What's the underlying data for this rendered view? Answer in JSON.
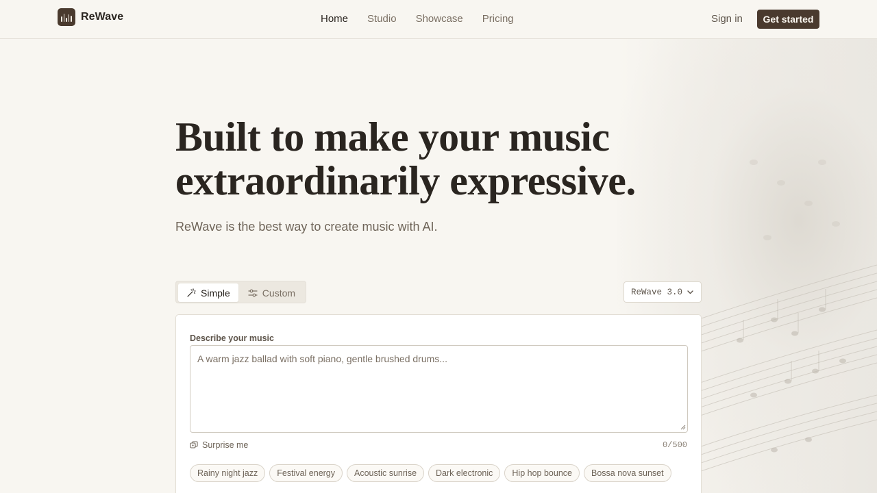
{
  "brand": {
    "name": "ReWave",
    "logo_icon": "bars-logo-icon"
  },
  "nav": {
    "items": [
      {
        "label": "Home",
        "active": true
      },
      {
        "label": "Studio",
        "active": false
      },
      {
        "label": "Showcase",
        "active": false
      },
      {
        "label": "Pricing",
        "active": false
      }
    ]
  },
  "header": {
    "signin_label": "Sign in",
    "cta_label": "Get started"
  },
  "hero": {
    "title_line1": "Built to make your music",
    "title_line2": "extraordinarily expressive.",
    "subtitle": "ReWave is the best way to create music with AI."
  },
  "mode": {
    "options": [
      {
        "label": "Simple",
        "icon": "magic-wand-icon",
        "active": true
      },
      {
        "label": "Custom",
        "icon": "sliders-icon",
        "active": false
      }
    ]
  },
  "model": {
    "selected": "ReWave 3.0",
    "icon": "chevron-down-icon"
  },
  "composer": {
    "label": "Describe your music",
    "placeholder": "A warm jazz ballad with soft piano, gentle brushed drums...",
    "value": "",
    "surprise_label": "Surprise me",
    "counter": "0/500",
    "suggestions": [
      "Rainy night jazz",
      "Festival energy",
      "Acoustic sunrise",
      "Dark electronic",
      "Hip hop bounce",
      "Bossa nova sunset"
    ]
  },
  "colors": {
    "background": "#f8f6f1",
    "accent": "#4a3a2e",
    "text": "#2a2520",
    "muted": "#7a6f63"
  }
}
